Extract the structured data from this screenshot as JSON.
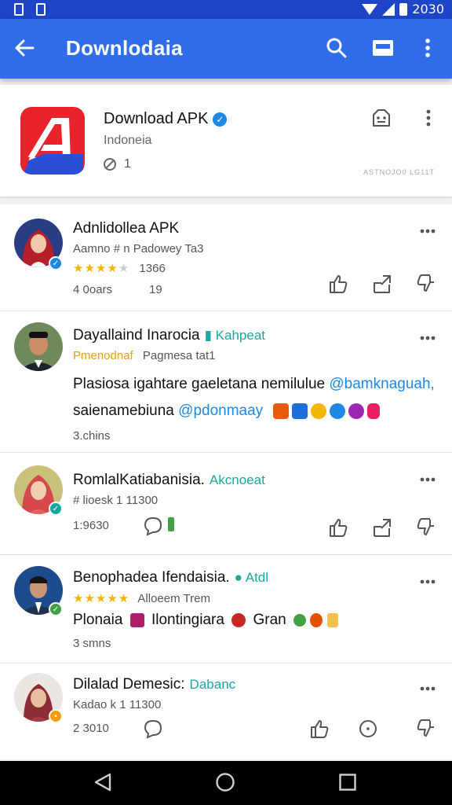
{
  "status_bar": {
    "time": "2030"
  },
  "app_bar": {
    "title": "Downlodaia"
  },
  "app_header": {
    "name": "Download APK",
    "subtitle": "Indoneia",
    "count": "1",
    "tiny_caption": "ASTNOJO0 LG11T"
  },
  "posts": [
    {
      "name": "Adnlidollea APK",
      "sub": "Aamno # n Padowey Ta3",
      "rating_text": "1366",
      "stars_on": 4,
      "meta": "4 0oars",
      "meta2": "19"
    },
    {
      "name": "Dayallaind Inarocia",
      "tag": "Kahpeat",
      "sub_accent": "Pmenodnaf",
      "sub": "Pagmesa tat1",
      "text_line1_a": "Plasiosa igahtare gaeletana nemilulue ",
      "text_line1_mention": "@bamknaguah,",
      "text_line2_a": "saienamebiuna ",
      "text_line2_mention": "@pdonmaay",
      "meta": "3.chins"
    },
    {
      "name": "RomlalKatiabanisia.",
      "tag": "Akcnoeat",
      "sub": "# lioesk 1 11300",
      "meta": "1:9630"
    },
    {
      "name": "Benophadea Ifendaisia.",
      "tag": "Atdl",
      "sub": "Alloeem Trem",
      "stars_on": 5,
      "text_a": "Plonaia",
      "text_b": "Ilontingiara",
      "text_c": "Gran",
      "meta": "3 smns"
    },
    {
      "name": "Dilalad Demesic:",
      "tag": "Dabanc",
      "sub": "Kadao k 1 11300",
      "meta": "2 3010"
    }
  ],
  "colors": {
    "status_bar": "#1e44c8",
    "app_bar": "#2f6ee8",
    "accent_teal": "#1ba7a0",
    "mention_blue": "#1e88e5",
    "star": "#f4b400"
  },
  "icons": [
    "back-arrow-icon",
    "search-icon",
    "inbox-icon",
    "more-vert-icon",
    "verified-icon",
    "share-icon",
    "thumb-up-icon",
    "thumb-down-icon",
    "comment-icon",
    "nav-back-icon",
    "nav-home-icon",
    "nav-recents-icon"
  ]
}
